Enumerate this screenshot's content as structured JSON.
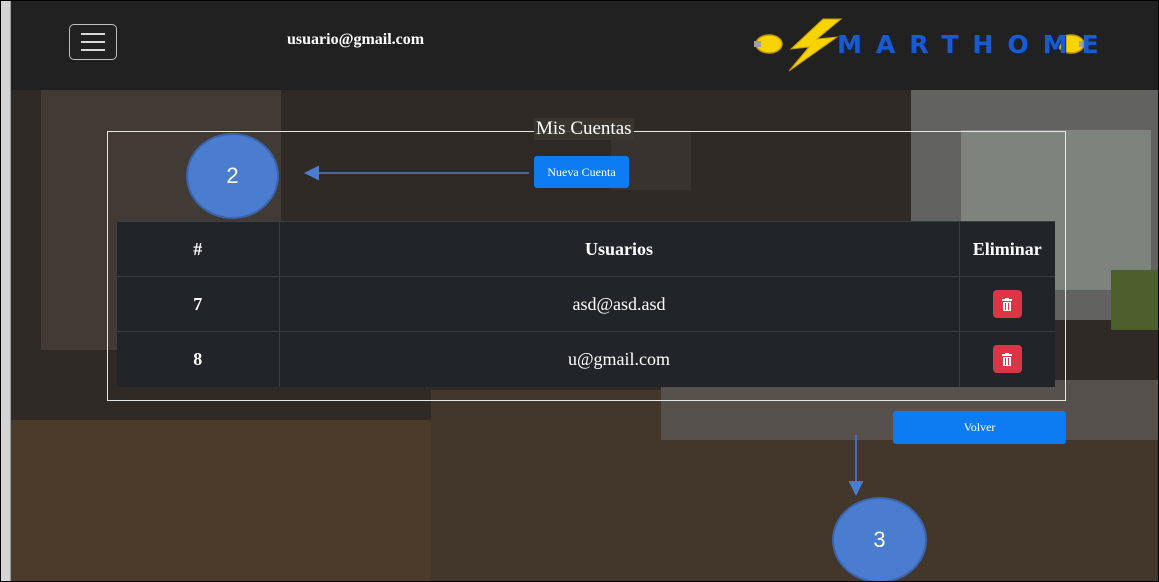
{
  "navbar": {
    "user_email": "usuario@gmail.com",
    "logo_text": "MARTHOME"
  },
  "panel": {
    "legend": "Mis Cuentas",
    "new_account_label": "Nueva Cuenta",
    "back_label": "Volver"
  },
  "table": {
    "headers": [
      "#",
      "Usuarios",
      "Eliminar"
    ],
    "rows": [
      {
        "id": "7",
        "user": "asd@asd.asd"
      },
      {
        "id": "8",
        "user": "u@gmail.com"
      }
    ]
  },
  "callouts": {
    "c2": "2",
    "c3": "3"
  },
  "colors": {
    "navbar": "#212121",
    "primary": "#0d7bf2",
    "danger": "#dc3545",
    "table_bg": "#212529",
    "callout": "#4a7cd0"
  },
  "icons": {
    "menu": "hamburger-icon",
    "delete": "trash-icon",
    "logo_bulb": "lightbulb-icon",
    "logo_bolt": "lightning-bolt-icon"
  }
}
